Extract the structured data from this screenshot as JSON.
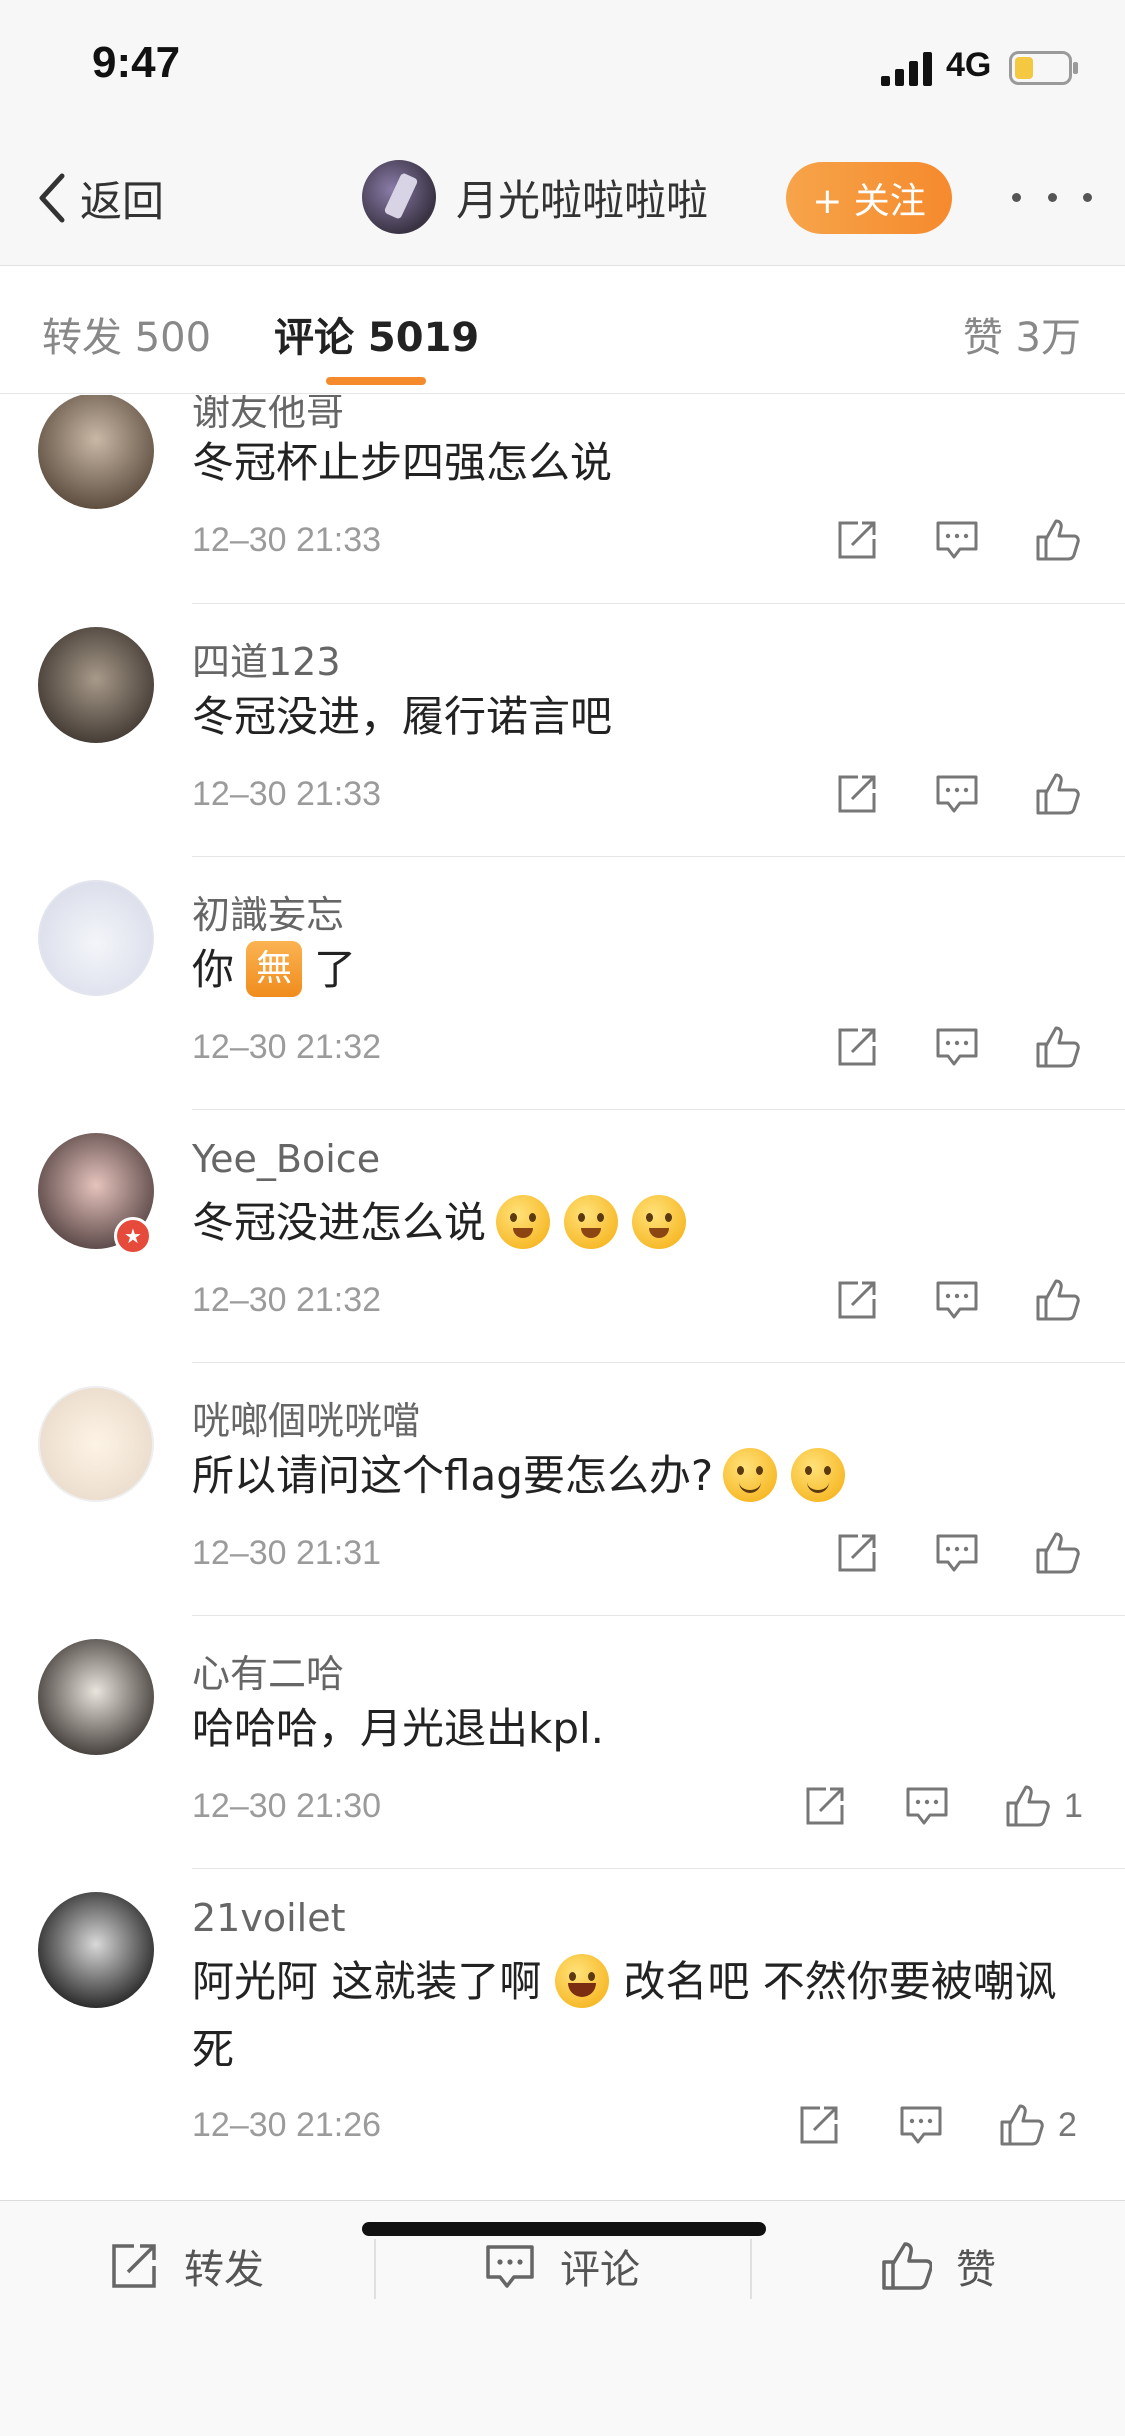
{
  "status_bar": {
    "time": "9:47",
    "network": "4G",
    "battery_color": "#f5c842"
  },
  "nav": {
    "back_label": "返回",
    "author_name": "月光啦啦啦啦",
    "follow_label": "+ 关注",
    "accent": "#f58a2d"
  },
  "tabs": {
    "repost": "转发 500",
    "comment": "评论 5019",
    "like": "赞 3万"
  },
  "comments": [
    {
      "user": "谢友他哥",
      "text": "冬冠杯止步四强怎么说",
      "time": "12–30 21:33"
    },
    {
      "user": "四道123",
      "text": "冬冠没进，履行诺言吧",
      "time": "12–30 21:33"
    },
    {
      "user": "初識妄忘",
      "text_before": "你",
      "badge": "無",
      "text_after": "了",
      "time": "12–30 21:32"
    },
    {
      "user": "Yee_Boice",
      "text": "冬冠没进怎么说",
      "emoji": "blush-emoji x3",
      "time": "12–30 21:32"
    },
    {
      "user": "咣啷個咣咣噹",
      "text": "所以请问这个flag要怎么办?",
      "emoji": "smile-emoji x2",
      "time": "12–30 21:31"
    },
    {
      "user": "心有二哈",
      "text": "哈哈哈，月光退出kpl.",
      "time": "12–30 21:30",
      "likes": "1"
    },
    {
      "user": "21voilet",
      "text_before": "阿光阿 这就装了啊",
      "text_after": "改名吧 不然你要被嘲讽死",
      "emoji": "laugh-cry-emoji",
      "time": "12–30 21:26",
      "likes": "2"
    }
  ],
  "bottom_bar": {
    "repost": "转发",
    "comment": "评论",
    "like": "赞"
  }
}
